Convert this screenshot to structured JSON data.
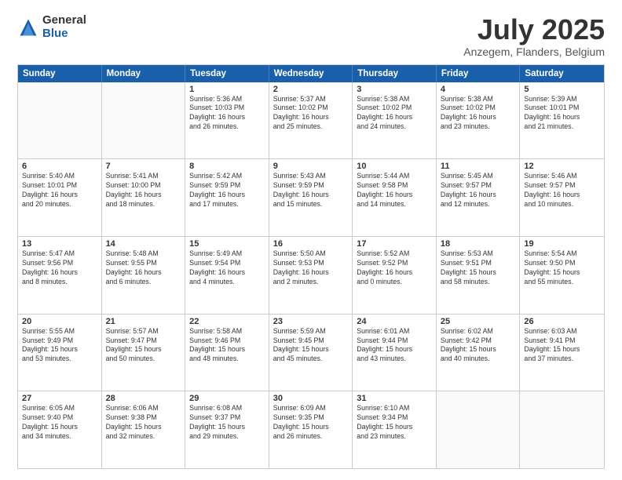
{
  "logo": {
    "general": "General",
    "blue": "Blue"
  },
  "header": {
    "month": "July 2025",
    "location": "Anzegem, Flanders, Belgium"
  },
  "days_of_week": [
    "Sunday",
    "Monday",
    "Tuesday",
    "Wednesday",
    "Thursday",
    "Friday",
    "Saturday"
  ],
  "weeks": [
    [
      {
        "day": "",
        "info": ""
      },
      {
        "day": "",
        "info": ""
      },
      {
        "day": "1",
        "info": "Sunrise: 5:36 AM\nSunset: 10:03 PM\nDaylight: 16 hours\nand 26 minutes."
      },
      {
        "day": "2",
        "info": "Sunrise: 5:37 AM\nSunset: 10:02 PM\nDaylight: 16 hours\nand 25 minutes."
      },
      {
        "day": "3",
        "info": "Sunrise: 5:38 AM\nSunset: 10:02 PM\nDaylight: 16 hours\nand 24 minutes."
      },
      {
        "day": "4",
        "info": "Sunrise: 5:38 AM\nSunset: 10:02 PM\nDaylight: 16 hours\nand 23 minutes."
      },
      {
        "day": "5",
        "info": "Sunrise: 5:39 AM\nSunset: 10:01 PM\nDaylight: 16 hours\nand 21 minutes."
      }
    ],
    [
      {
        "day": "6",
        "info": "Sunrise: 5:40 AM\nSunset: 10:01 PM\nDaylight: 16 hours\nand 20 minutes."
      },
      {
        "day": "7",
        "info": "Sunrise: 5:41 AM\nSunset: 10:00 PM\nDaylight: 16 hours\nand 18 minutes."
      },
      {
        "day": "8",
        "info": "Sunrise: 5:42 AM\nSunset: 9:59 PM\nDaylight: 16 hours\nand 17 minutes."
      },
      {
        "day": "9",
        "info": "Sunrise: 5:43 AM\nSunset: 9:59 PM\nDaylight: 16 hours\nand 15 minutes."
      },
      {
        "day": "10",
        "info": "Sunrise: 5:44 AM\nSunset: 9:58 PM\nDaylight: 16 hours\nand 14 minutes."
      },
      {
        "day": "11",
        "info": "Sunrise: 5:45 AM\nSunset: 9:57 PM\nDaylight: 16 hours\nand 12 minutes."
      },
      {
        "day": "12",
        "info": "Sunrise: 5:46 AM\nSunset: 9:57 PM\nDaylight: 16 hours\nand 10 minutes."
      }
    ],
    [
      {
        "day": "13",
        "info": "Sunrise: 5:47 AM\nSunset: 9:56 PM\nDaylight: 16 hours\nand 8 minutes."
      },
      {
        "day": "14",
        "info": "Sunrise: 5:48 AM\nSunset: 9:55 PM\nDaylight: 16 hours\nand 6 minutes."
      },
      {
        "day": "15",
        "info": "Sunrise: 5:49 AM\nSunset: 9:54 PM\nDaylight: 16 hours\nand 4 minutes."
      },
      {
        "day": "16",
        "info": "Sunrise: 5:50 AM\nSunset: 9:53 PM\nDaylight: 16 hours\nand 2 minutes."
      },
      {
        "day": "17",
        "info": "Sunrise: 5:52 AM\nSunset: 9:52 PM\nDaylight: 16 hours\nand 0 minutes."
      },
      {
        "day": "18",
        "info": "Sunrise: 5:53 AM\nSunset: 9:51 PM\nDaylight: 15 hours\nand 58 minutes."
      },
      {
        "day": "19",
        "info": "Sunrise: 5:54 AM\nSunset: 9:50 PM\nDaylight: 15 hours\nand 55 minutes."
      }
    ],
    [
      {
        "day": "20",
        "info": "Sunrise: 5:55 AM\nSunset: 9:49 PM\nDaylight: 15 hours\nand 53 minutes."
      },
      {
        "day": "21",
        "info": "Sunrise: 5:57 AM\nSunset: 9:47 PM\nDaylight: 15 hours\nand 50 minutes."
      },
      {
        "day": "22",
        "info": "Sunrise: 5:58 AM\nSunset: 9:46 PM\nDaylight: 15 hours\nand 48 minutes."
      },
      {
        "day": "23",
        "info": "Sunrise: 5:59 AM\nSunset: 9:45 PM\nDaylight: 15 hours\nand 45 minutes."
      },
      {
        "day": "24",
        "info": "Sunrise: 6:01 AM\nSunset: 9:44 PM\nDaylight: 15 hours\nand 43 minutes."
      },
      {
        "day": "25",
        "info": "Sunrise: 6:02 AM\nSunset: 9:42 PM\nDaylight: 15 hours\nand 40 minutes."
      },
      {
        "day": "26",
        "info": "Sunrise: 6:03 AM\nSunset: 9:41 PM\nDaylight: 15 hours\nand 37 minutes."
      }
    ],
    [
      {
        "day": "27",
        "info": "Sunrise: 6:05 AM\nSunset: 9:40 PM\nDaylight: 15 hours\nand 34 minutes."
      },
      {
        "day": "28",
        "info": "Sunrise: 6:06 AM\nSunset: 9:38 PM\nDaylight: 15 hours\nand 32 minutes."
      },
      {
        "day": "29",
        "info": "Sunrise: 6:08 AM\nSunset: 9:37 PM\nDaylight: 15 hours\nand 29 minutes."
      },
      {
        "day": "30",
        "info": "Sunrise: 6:09 AM\nSunset: 9:35 PM\nDaylight: 15 hours\nand 26 minutes."
      },
      {
        "day": "31",
        "info": "Sunrise: 6:10 AM\nSunset: 9:34 PM\nDaylight: 15 hours\nand 23 minutes."
      },
      {
        "day": "",
        "info": ""
      },
      {
        "day": "",
        "info": ""
      }
    ]
  ]
}
